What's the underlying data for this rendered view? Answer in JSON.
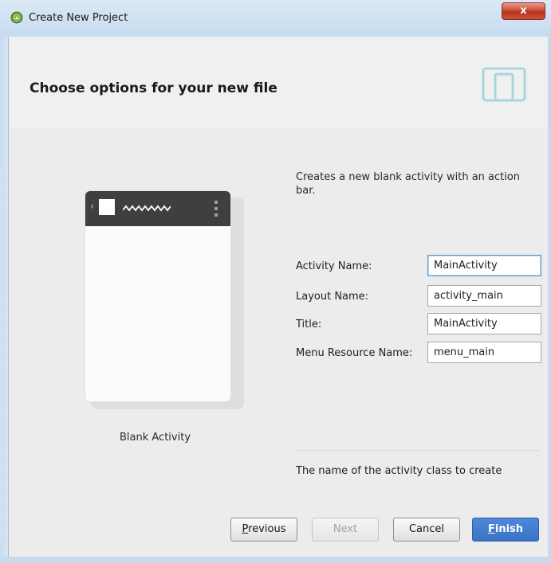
{
  "window": {
    "title": "Create New Project",
    "close_label": "x"
  },
  "page": {
    "title": "Choose options for your new file",
    "device_icon": "tablet-phone-icon"
  },
  "preview": {
    "label": "Blank Activity",
    "back_glyph": "‹"
  },
  "description": "Creates a new blank activity with an action bar.",
  "form": {
    "activity_name": {
      "label": "Activity Name:",
      "value": "MainActivity"
    },
    "layout_name": {
      "label": "Layout Name:",
      "value": "activity_main"
    },
    "title": {
      "label": "Title:",
      "value": "MainActivity"
    },
    "menu_resource_name": {
      "label": "Menu Resource Name:",
      "value": "menu_main"
    }
  },
  "hint": "The name of the activity class to create",
  "buttons": {
    "previous_first": "P",
    "previous_rest": "revious",
    "next": "Next",
    "cancel": "Cancel",
    "finish_first": "F",
    "finish_rest": "inish"
  },
  "colors": {
    "accent": "#3a72c4",
    "titlebar": "#c7dbef",
    "close": "#c9462f"
  }
}
